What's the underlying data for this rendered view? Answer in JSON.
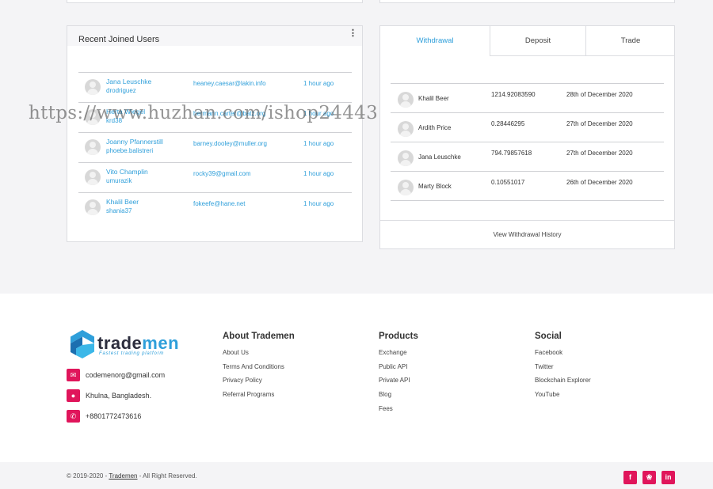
{
  "recent_users": {
    "title": "Recent Joined Users",
    "menu_icon": "more-vertical-icon",
    "rows": [
      {
        "name": "Jana Leuschke",
        "handle": "drodriguez",
        "email": "heaney.caesar@lakin.info",
        "time": "1 hour ago"
      },
      {
        "name": "Herta Wiegel",
        "handle": "krd38",
        "email": "hermann.carter@batz.org",
        "time": "1 hour ago"
      },
      {
        "name": "Joanny Pfannerstill",
        "handle": "phoebe.balistreri",
        "email": "barney.dooley@muller.org",
        "time": "1 hour ago"
      },
      {
        "name": "Vito Champlin",
        "handle": "umurazik",
        "email": "rocky39@gmail.com",
        "time": "1 hour ago"
      },
      {
        "name": "Khalil Beer",
        "handle": "shania37",
        "email": "fokeefe@hane.net",
        "time": "1 hour ago"
      }
    ]
  },
  "transactions": {
    "tabs": [
      "Withdrawal",
      "Deposit",
      "Trade"
    ],
    "active_tab": "Withdrawal",
    "rows": [
      {
        "name": "Khalil Beer",
        "amount": "1214.92083590",
        "date": "28th of December 2020"
      },
      {
        "name": "Ardith Price",
        "amount": "0.28446295",
        "date": "27th of December 2020"
      },
      {
        "name": "Jana Leuschke",
        "amount": "794.79857618",
        "date": "27th of December 2020"
      },
      {
        "name": "Marty Block",
        "amount": "0.10551017",
        "date": "26th of December 2020"
      }
    ],
    "history_link": "View Withdrawal History"
  },
  "footer": {
    "brand": {
      "word_a": "trade",
      "word_b": "men",
      "tagline": "Fastest trading platform"
    },
    "contacts": [
      {
        "icon": "mail-icon",
        "text": "codemenorg@gmail.com"
      },
      {
        "icon": "location-pin-icon",
        "text": "Khulna, Bangladesh."
      },
      {
        "icon": "phone-icon",
        "text": "+8801772473616"
      }
    ],
    "columns": [
      {
        "title": "About Trademen",
        "links": [
          "About Us",
          "Terms And Conditions",
          "Privacy Policy",
          "Referral Programs"
        ]
      },
      {
        "title": "Products",
        "links": [
          "Exchange",
          "Public API",
          "Private API",
          "Blog",
          "Fees"
        ]
      },
      {
        "title": "Social",
        "links": [
          "Facebook",
          "Twitter",
          "Blockchain Explorer",
          "YouTube"
        ]
      }
    ]
  },
  "bottom_bar": {
    "copyright_prefix": "© 2019-2020 - ",
    "copyright_link": "Trademen",
    "copyright_suffix": " - All Right Reserved.",
    "social_icons": [
      "facebook-icon",
      "twitter-icon",
      "linkedin-icon"
    ]
  },
  "watermark": "https://www.huzhan.com/ishop24443",
  "colors": {
    "accent_blue": "#2f9fda",
    "accent_pink": "#e0155b",
    "brand_dark": "#2c2d3d"
  }
}
